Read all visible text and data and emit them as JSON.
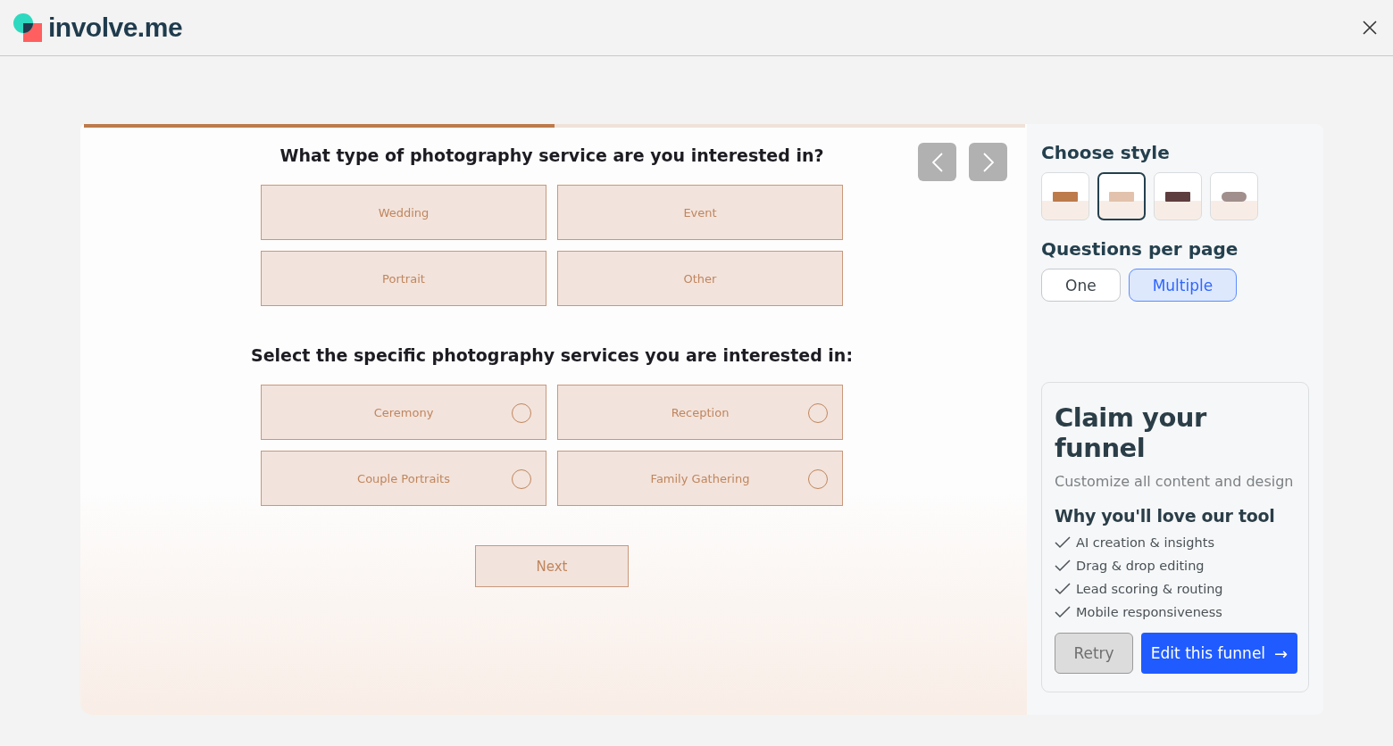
{
  "header": {
    "logo_text": "involve.me"
  },
  "quiz": {
    "progress": {
      "level": 0.5
    },
    "sections": [
      {
        "title": "What type of photography service are you interested in?",
        "kind": "choice",
        "options": [
          {
            "label": "Wedding",
            "selected": false
          },
          {
            "label": "Event",
            "selected": false
          },
          {
            "label": "Portrait",
            "selected": false
          },
          {
            "label": "Other",
            "selected": false
          }
        ]
      },
      {
        "title": "Select the specific photography services you are interested in:",
        "kind": "radio",
        "options": [
          {
            "label": "Ceremony",
            "selected": false
          },
          {
            "label": "Reception",
            "selected": false
          },
          {
            "label": "Couple Portraits",
            "selected": false
          },
          {
            "label": "Family Gathering",
            "selected": false
          }
        ]
      }
    ],
    "next_button": "Next"
  },
  "sidebar": {
    "style_title": "Choose style",
    "styles": [
      {
        "color": "#bd7a4b",
        "selected": false
      },
      {
        "color": "#e2c2ac",
        "selected": true
      },
      {
        "color": "#5e3d3f",
        "selected": false
      },
      {
        "color": "#a08f8c",
        "selected": false
      }
    ],
    "qpp_title": "Questions per page",
    "qpp_options": [
      {
        "label": "One",
        "selected": false
      },
      {
        "label": "Multiple",
        "selected": true
      }
    ],
    "promo": {
      "title": "Claim your funnel",
      "subtitle": "Customize all content and design",
      "why_title": "Why you'll love our tool",
      "features": [
        "AI creation & insights",
        "Drag & drop editing",
        "Lead scoring & routing",
        "Mobile responsiveness"
      ],
      "retry_button": "Retry",
      "edit_button": "Edit this funnel",
      "edit_arrow": "→"
    }
  }
}
